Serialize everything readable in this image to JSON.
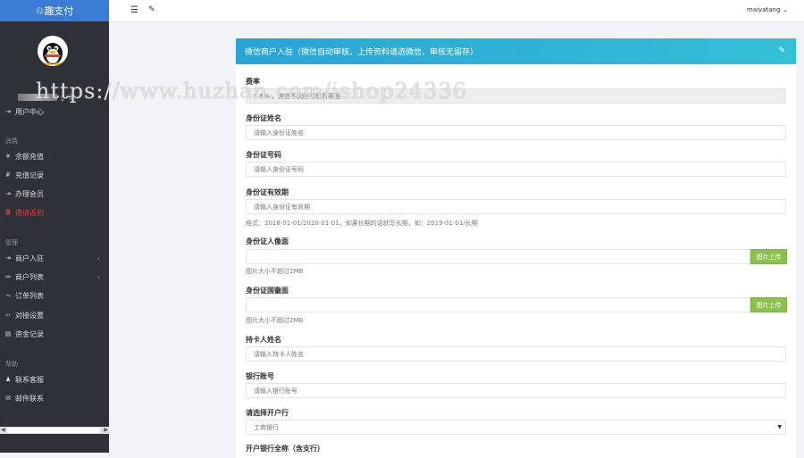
{
  "sidebar": {
    "logo": "趣支付",
    "logo_prefix": "♲",
    "profile_icons": [
      "◊",
      "⎆"
    ],
    "user_center": "用户中心",
    "sections": [
      {
        "title": "消费",
        "items": [
          "余额充值",
          "充值记录",
          "办理会员",
          "邀请返利"
        ]
      },
      {
        "title": "管理",
        "items": [
          "商户入驻",
          "商户列表",
          "订单列表",
          "对接设置",
          "资金记录"
        ]
      },
      {
        "title": "帮助",
        "items": [
          "联系客服",
          "邮件联系"
        ]
      }
    ]
  },
  "topbar": {
    "username": "maiyatang",
    "menu_icon": "☰",
    "tool_icon": "✎"
  },
  "card": {
    "title": "微信商户入驻（微信自动审核，上传资料请选微信，审核无留存）"
  },
  "form": {
    "rate_label": "费率",
    "rate_value": "0.6% ，微信不到账可联系客服",
    "id_name_label": "身份证姓名",
    "id_name_placeholder": "请输入身份证姓名",
    "id_number_label": "身份证号码",
    "id_number_placeholder": "请输入身份证号码",
    "id_validity_label": "身份证有效期",
    "id_validity_placeholder": "请输入身份证有效期",
    "id_validity_hint": "格式：2018-01-01/2020-01-01。如果长期的话就写长期，如：2019-01-01/长期",
    "id_front_label": "身份证人像面",
    "upload_label": "图片上传",
    "size_hint": "图片大小不超过2MB",
    "id_back_label": "身份证国徽面",
    "card_holder_label": "持卡人姓名",
    "card_holder_placeholder": "请输入持卡人姓名",
    "bank_account_label": "银行账号",
    "bank_account_placeholder": "请输入银行账号",
    "bank_select_label": "请选择开户行",
    "bank_select_value": "工商银行",
    "branch_label": "开户银行全称（含支行）"
  },
  "watermark": "https://www.huzhan.com/ishop24336"
}
